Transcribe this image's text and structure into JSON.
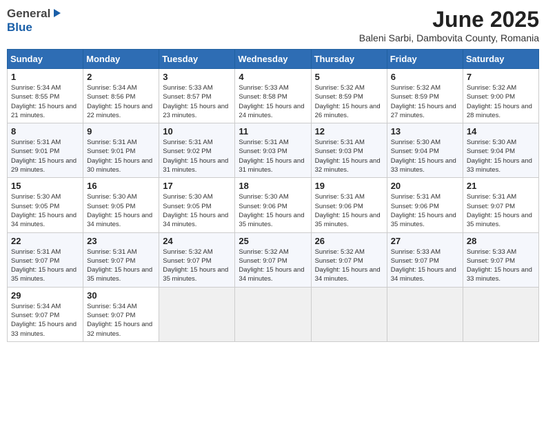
{
  "header": {
    "logo": {
      "general": "General",
      "blue": "Blue",
      "icon": "▶"
    },
    "title": "June 2025",
    "subtitle": "Baleni Sarbi, Dambovita County, Romania"
  },
  "weekdays": [
    "Sunday",
    "Monday",
    "Tuesday",
    "Wednesday",
    "Thursday",
    "Friday",
    "Saturday"
  ],
  "weeks": [
    [
      {
        "day": "1",
        "sunrise": "Sunrise: 5:34 AM",
        "sunset": "Sunset: 8:55 PM",
        "daylight": "Daylight: 15 hours and 21 minutes."
      },
      {
        "day": "2",
        "sunrise": "Sunrise: 5:34 AM",
        "sunset": "Sunset: 8:56 PM",
        "daylight": "Daylight: 15 hours and 22 minutes."
      },
      {
        "day": "3",
        "sunrise": "Sunrise: 5:33 AM",
        "sunset": "Sunset: 8:57 PM",
        "daylight": "Daylight: 15 hours and 23 minutes."
      },
      {
        "day": "4",
        "sunrise": "Sunrise: 5:33 AM",
        "sunset": "Sunset: 8:58 PM",
        "daylight": "Daylight: 15 hours and 24 minutes."
      },
      {
        "day": "5",
        "sunrise": "Sunrise: 5:32 AM",
        "sunset": "Sunset: 8:59 PM",
        "daylight": "Daylight: 15 hours and 26 minutes."
      },
      {
        "day": "6",
        "sunrise": "Sunrise: 5:32 AM",
        "sunset": "Sunset: 8:59 PM",
        "daylight": "Daylight: 15 hours and 27 minutes."
      },
      {
        "day": "7",
        "sunrise": "Sunrise: 5:32 AM",
        "sunset": "Sunset: 9:00 PM",
        "daylight": "Daylight: 15 hours and 28 minutes."
      }
    ],
    [
      {
        "day": "8",
        "sunrise": "Sunrise: 5:31 AM",
        "sunset": "Sunset: 9:01 PM",
        "daylight": "Daylight: 15 hours and 29 minutes."
      },
      {
        "day": "9",
        "sunrise": "Sunrise: 5:31 AM",
        "sunset": "Sunset: 9:01 PM",
        "daylight": "Daylight: 15 hours and 30 minutes."
      },
      {
        "day": "10",
        "sunrise": "Sunrise: 5:31 AM",
        "sunset": "Sunset: 9:02 PM",
        "daylight": "Daylight: 15 hours and 31 minutes."
      },
      {
        "day": "11",
        "sunrise": "Sunrise: 5:31 AM",
        "sunset": "Sunset: 9:03 PM",
        "daylight": "Daylight: 15 hours and 31 minutes."
      },
      {
        "day": "12",
        "sunrise": "Sunrise: 5:31 AM",
        "sunset": "Sunset: 9:03 PM",
        "daylight": "Daylight: 15 hours and 32 minutes."
      },
      {
        "day": "13",
        "sunrise": "Sunrise: 5:30 AM",
        "sunset": "Sunset: 9:04 PM",
        "daylight": "Daylight: 15 hours and 33 minutes."
      },
      {
        "day": "14",
        "sunrise": "Sunrise: 5:30 AM",
        "sunset": "Sunset: 9:04 PM",
        "daylight": "Daylight: 15 hours and 33 minutes."
      }
    ],
    [
      {
        "day": "15",
        "sunrise": "Sunrise: 5:30 AM",
        "sunset": "Sunset: 9:05 PM",
        "daylight": "Daylight: 15 hours and 34 minutes."
      },
      {
        "day": "16",
        "sunrise": "Sunrise: 5:30 AM",
        "sunset": "Sunset: 9:05 PM",
        "daylight": "Daylight: 15 hours and 34 minutes."
      },
      {
        "day": "17",
        "sunrise": "Sunrise: 5:30 AM",
        "sunset": "Sunset: 9:05 PM",
        "daylight": "Daylight: 15 hours and 34 minutes."
      },
      {
        "day": "18",
        "sunrise": "Sunrise: 5:30 AM",
        "sunset": "Sunset: 9:06 PM",
        "daylight": "Daylight: 15 hours and 35 minutes."
      },
      {
        "day": "19",
        "sunrise": "Sunrise: 5:31 AM",
        "sunset": "Sunset: 9:06 PM",
        "daylight": "Daylight: 15 hours and 35 minutes."
      },
      {
        "day": "20",
        "sunrise": "Sunrise: 5:31 AM",
        "sunset": "Sunset: 9:06 PM",
        "daylight": "Daylight: 15 hours and 35 minutes."
      },
      {
        "day": "21",
        "sunrise": "Sunrise: 5:31 AM",
        "sunset": "Sunset: 9:07 PM",
        "daylight": "Daylight: 15 hours and 35 minutes."
      }
    ],
    [
      {
        "day": "22",
        "sunrise": "Sunrise: 5:31 AM",
        "sunset": "Sunset: 9:07 PM",
        "daylight": "Daylight: 15 hours and 35 minutes."
      },
      {
        "day": "23",
        "sunrise": "Sunrise: 5:31 AM",
        "sunset": "Sunset: 9:07 PM",
        "daylight": "Daylight: 15 hours and 35 minutes."
      },
      {
        "day": "24",
        "sunrise": "Sunrise: 5:32 AM",
        "sunset": "Sunset: 9:07 PM",
        "daylight": "Daylight: 15 hours and 35 minutes."
      },
      {
        "day": "25",
        "sunrise": "Sunrise: 5:32 AM",
        "sunset": "Sunset: 9:07 PM",
        "daylight": "Daylight: 15 hours and 34 minutes."
      },
      {
        "day": "26",
        "sunrise": "Sunrise: 5:32 AM",
        "sunset": "Sunset: 9:07 PM",
        "daylight": "Daylight: 15 hours and 34 minutes."
      },
      {
        "day": "27",
        "sunrise": "Sunrise: 5:33 AM",
        "sunset": "Sunset: 9:07 PM",
        "daylight": "Daylight: 15 hours and 34 minutes."
      },
      {
        "day": "28",
        "sunrise": "Sunrise: 5:33 AM",
        "sunset": "Sunset: 9:07 PM",
        "daylight": "Daylight: 15 hours and 33 minutes."
      }
    ],
    [
      {
        "day": "29",
        "sunrise": "Sunrise: 5:34 AM",
        "sunset": "Sunset: 9:07 PM",
        "daylight": "Daylight: 15 hours and 33 minutes."
      },
      {
        "day": "30",
        "sunrise": "Sunrise: 5:34 AM",
        "sunset": "Sunset: 9:07 PM",
        "daylight": "Daylight: 15 hours and 32 minutes."
      },
      null,
      null,
      null,
      null,
      null
    ]
  ]
}
